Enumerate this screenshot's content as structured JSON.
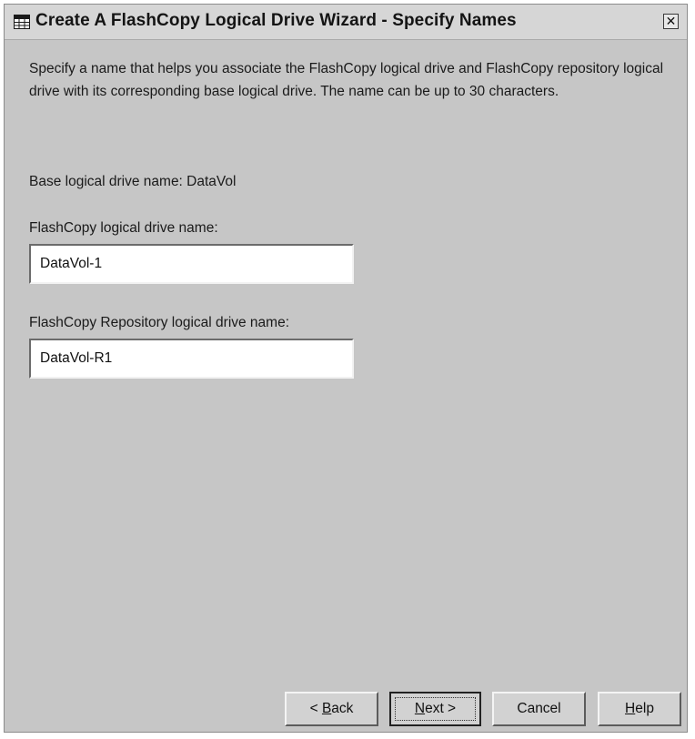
{
  "window": {
    "title": "Create A FlashCopy Logical Drive Wizard - Specify Names",
    "app_icon": "table-grid-icon",
    "close_glyph": "✕"
  },
  "instructions": {
    "text": "Specify a name that helps you associate the FlashCopy logical drive and FlashCopy repository logical drive with its corresponding base logical drive. The name can be up to 30 characters."
  },
  "base_drive": {
    "label_text": "Base logical drive name: DataVol"
  },
  "flashcopy_drive": {
    "label": "FlashCopy logical drive name:",
    "value": "DataVol-1"
  },
  "repository_drive": {
    "label": "FlashCopy Repository logical drive name:",
    "value": "DataVol-R1"
  },
  "buttons": {
    "back_prefix": "< ",
    "back_mnemonic": "B",
    "back_rest": "ack",
    "next_mnemonic": "N",
    "next_rest": "ext >",
    "cancel": "Cancel",
    "help_mnemonic": "H",
    "help_rest": "elp"
  }
}
